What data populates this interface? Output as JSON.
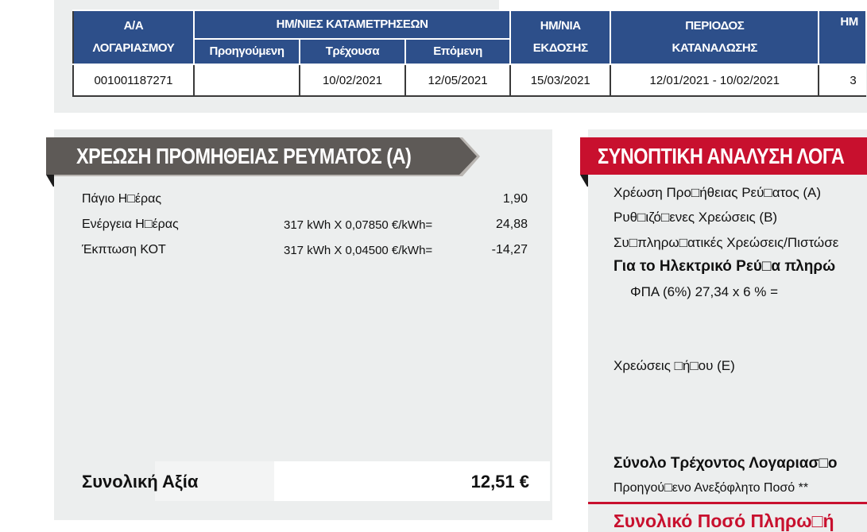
{
  "table": {
    "headers": {
      "account": [
        "Α/Α",
        "ΛΟΓΑΡΙΑΣΜΟΥ"
      ],
      "readings": "ΗΜ/ΝΙΕΣ ΚΑΤΑΜΕΤΡΗΣΕΩΝ",
      "previous": "Προηγούμενη",
      "current": "Τρέχουσα",
      "next": "Επόμενη",
      "issue": [
        "ΗΜ/ΝΙΑ",
        "ΕΚΔΟΣΗΣ"
      ],
      "period": [
        "ΠΕΡΙΟΔΟΣ",
        "ΚΑΤΑΝΑΛΩΣΗΣ"
      ],
      "clipped": "ΗΜ"
    },
    "row": {
      "account": "001001187271",
      "previous": "",
      "current": "10/02/2021",
      "next": "12/05/2021",
      "issue": "15/03/2021",
      "period": "12/01/2021 - 10/02/2021",
      "clipped": "3"
    }
  },
  "section_a": {
    "title": "ΧΡΕΩΣΗ ΠΡΟΜΗΘΕΙΑΣ ΡΕΥΜΑΤΟΣ (Α)",
    "rows": [
      {
        "label": "Πάγιο Η□έρας",
        "detail": "",
        "value": "1,90"
      },
      {
        "label": "Ενέργεια Η□έρας",
        "detail": "317 kWh X 0,07850 €/kWh=",
        "value": "24,88"
      },
      {
        "label": "Έκπτωση ΚΟΤ",
        "detail": "317 kWh X 0,04500 €/kWh=",
        "value": "-14,27"
      }
    ],
    "total_label": "Συνολική Αξία",
    "total_value": "12,51 €"
  },
  "section_b": {
    "title": "ΣΥΝΟΠΤΙΚΗ ΑΝΑΛΥΣΗ ΛΟΓΑ",
    "rows": {
      "supply": "Χρέωση Προ□ήθειας Ρεύ□ατος (Α)",
      "regulated": "Ρυθ□ιζό□ενες Χρεώσεις (Β)",
      "extra": "Συ□πληρω□ατικές Χρεώσεις/Πιστώσε",
      "electric_heading": "Για το Ηλεκτρικό Ρεύ□α πληρώ",
      "vat": "ΦΠΑ (6%) 27,34 x 6 %  =",
      "municipal": "Χρεώσεις □ή□ου (Ε)",
      "current_total": "Σύνολο Τρέχοντος Λογαριασ□ο",
      "previous_unpaid": "Προηγού□ενο Ανεξόφλητο Ποσό **",
      "grand_total": "Συνολικό Ποσό Πληρω□ή"
    }
  },
  "colors": {
    "header_blue": "#2d4f8a",
    "banner_grey": "#5e5a57",
    "banner_red": "#c8102e",
    "panel_grey": "#eceeee"
  }
}
